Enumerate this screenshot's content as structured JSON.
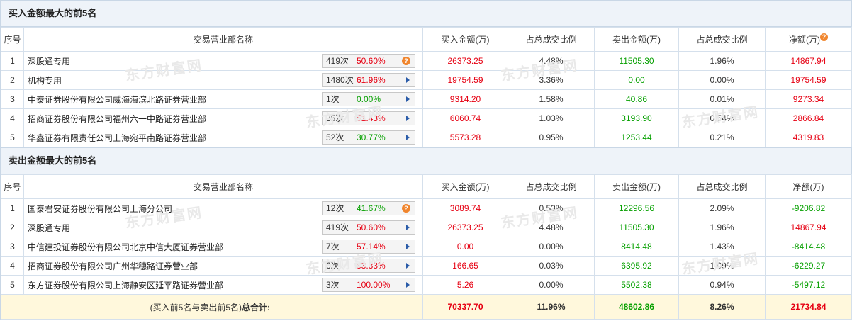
{
  "buy_section": {
    "title": "买入金额最大的前5名",
    "headers": [
      "序号",
      "交易营业部名称",
      "买入金额(万)",
      "占总成交比例",
      "卖出金额(万)",
      "占总成交比例",
      "净额(万)"
    ],
    "rows": [
      {
        "idx": "1",
        "name": "深股通专用",
        "times": "419次",
        "pct": "50.60%",
        "pct_color": "red",
        "icon": "help-icon",
        "buy": "26373.25",
        "buy_ratio": "4.48%",
        "sell": "11505.30",
        "sell_ratio": "1.96%",
        "net": "14867.94"
      },
      {
        "idx": "2",
        "name": "机构专用",
        "times": "1480次",
        "pct": "61.96%",
        "pct_color": "red",
        "icon": "arrow-icon",
        "buy": "19754.59",
        "buy_ratio": "3.36%",
        "sell": "0.00",
        "sell_ratio": "0.00%",
        "net": "19754.59"
      },
      {
        "idx": "3",
        "name": "中泰证券股份有限公司威海海滨北路证券营业部",
        "times": "1次",
        "pct": "0.00%",
        "pct_color": "green",
        "icon": "arrow-icon",
        "buy": "9314.20",
        "buy_ratio": "1.58%",
        "sell": "40.86",
        "sell_ratio": "0.01%",
        "net": "9273.34"
      },
      {
        "idx": "4",
        "name": "招商证券股份有限公司福州六一中路证券营业部",
        "times": "35次",
        "pct": "51.43%",
        "pct_color": "red",
        "icon": "arrow-icon",
        "buy": "6060.74",
        "buy_ratio": "1.03%",
        "sell": "3193.90",
        "sell_ratio": "0.54%",
        "net": "2866.84"
      },
      {
        "idx": "5",
        "name": "华鑫证券有限责任公司上海宛平南路证券营业部",
        "times": "52次",
        "pct": "30.77%",
        "pct_color": "green",
        "icon": "arrow-icon",
        "buy": "5573.28",
        "buy_ratio": "0.95%",
        "sell": "1253.44",
        "sell_ratio": "0.21%",
        "net": "4319.83"
      }
    ]
  },
  "sell_section": {
    "title": "卖出金额最大的前5名",
    "headers": [
      "序号",
      "交易营业部名称",
      "买入金额(万)",
      "占总成交比例",
      "卖出金额(万)",
      "占总成交比例",
      "净额(万)"
    ],
    "rows": [
      {
        "idx": "1",
        "name": "国泰君安证券股份有限公司上海分公司",
        "times": "12次",
        "pct": "41.67%",
        "pct_color": "green",
        "icon": "help-icon",
        "buy": "3089.74",
        "buy_ratio": "0.53%",
        "sell": "12296.56",
        "sell_ratio": "2.09%",
        "net": "-9206.82"
      },
      {
        "idx": "2",
        "name": "深股通专用",
        "times": "419次",
        "pct": "50.60%",
        "pct_color": "red",
        "icon": "arrow-icon",
        "buy": "26373.25",
        "buy_ratio": "4.48%",
        "sell": "11505.30",
        "sell_ratio": "1.96%",
        "net": "14867.94"
      },
      {
        "idx": "3",
        "name": "中信建投证券股份有限公司北京中信大厦证券营业部",
        "times": "7次",
        "pct": "57.14%",
        "pct_color": "red",
        "icon": "arrow-icon",
        "buy": "0.00",
        "buy_ratio": "0.00%",
        "sell": "8414.48",
        "sell_ratio": "1.43%",
        "net": "-8414.48"
      },
      {
        "idx": "4",
        "name": "招商证券股份有限公司广州华穗路证券营业部",
        "times": "6次",
        "pct": "83.33%",
        "pct_color": "red",
        "icon": "arrow-icon",
        "buy": "166.65",
        "buy_ratio": "0.03%",
        "sell": "6395.92",
        "sell_ratio": "1.09%",
        "net": "-6229.27"
      },
      {
        "idx": "5",
        "name": "东方证券股份有限公司上海静安区延平路证券营业部",
        "times": "3次",
        "pct": "100.00%",
        "pct_color": "red",
        "icon": "arrow-icon",
        "buy": "5.26",
        "buy_ratio": "0.00%",
        "sell": "5502.38",
        "sell_ratio": "0.94%",
        "net": "-5497.12"
      }
    ]
  },
  "total": {
    "label_prefix": "(买入前5名与卖出前5名)",
    "label_bold": "总合计:",
    "buy": "70337.70",
    "buy_ratio": "11.96%",
    "sell": "48602.86",
    "sell_ratio": "8.26%",
    "net": "21734.84"
  },
  "help_icon_glyph": "?",
  "watermark": {
    "brand": "东方财富网",
    "domain": "eastmoney.com"
  },
  "colors": {
    "red": "#e60012",
    "green": "#06a000",
    "accent_blue": "#2a5ba8",
    "help_orange": "#f0852d"
  }
}
